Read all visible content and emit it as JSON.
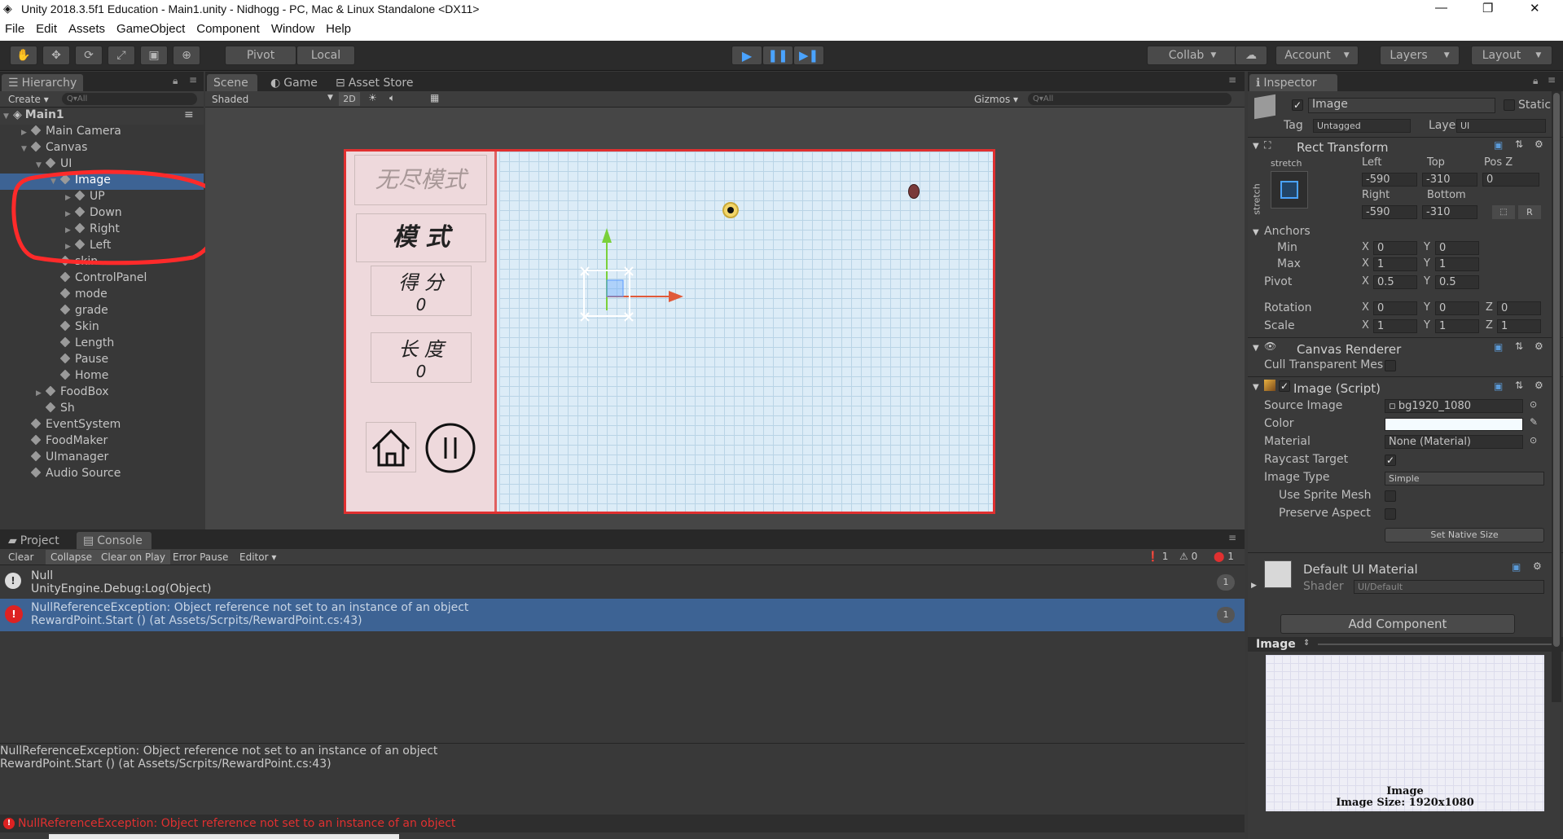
{
  "window": {
    "title": "Unity 2018.3.5f1 Education - Main1.unity - Nidhogg - PC, Mac & Linux Standalone <DX11>",
    "minimize": "—",
    "maximize": "❐",
    "close": "✕"
  },
  "menu": [
    "File",
    "Edit",
    "Assets",
    "GameObject",
    "Component",
    "Window",
    "Help"
  ],
  "toolbar": {
    "pivot": "Pivot",
    "local": "Local",
    "collab": "Collab",
    "account": "Account",
    "layers": "Layers",
    "layout": "Layout",
    "tools": [
      "✋",
      "✥",
      "⟳",
      "⤢",
      "▣",
      "⊕"
    ]
  },
  "hierarchy": {
    "tab": "Hierarchy",
    "create": "Create",
    "search_placeholder": "Q▾All",
    "scene": "Main1",
    "items": [
      {
        "label": "Main Camera",
        "depth": 1,
        "arrow": "▶"
      },
      {
        "label": "Canvas",
        "depth": 1,
        "arrow": "▼"
      },
      {
        "label": "UI",
        "depth": 2,
        "arrow": "▼"
      },
      {
        "label": "Image",
        "depth": 3,
        "arrow": "▼",
        "selected": true
      },
      {
        "label": "UP",
        "depth": 4,
        "arrow": "▶"
      },
      {
        "label": "Down",
        "depth": 4,
        "arrow": "▶"
      },
      {
        "label": "Right",
        "depth": 4,
        "arrow": "▶"
      },
      {
        "label": "Left",
        "depth": 4,
        "arrow": "▶"
      },
      {
        "label": "skin",
        "depth": 3,
        "arrow": ""
      },
      {
        "label": "ControlPanel",
        "depth": 3,
        "arrow": ""
      },
      {
        "label": "mode",
        "depth": 3,
        "arrow": ""
      },
      {
        "label": "grade",
        "depth": 3,
        "arrow": ""
      },
      {
        "label": "Skin",
        "depth": 3,
        "arrow": ""
      },
      {
        "label": "Length",
        "depth": 3,
        "arrow": ""
      },
      {
        "label": "Pause",
        "depth": 3,
        "arrow": ""
      },
      {
        "label": "Home",
        "depth": 3,
        "arrow": ""
      },
      {
        "label": "FoodBox",
        "depth": 2,
        "arrow": "▶"
      },
      {
        "label": "Sh",
        "depth": 2,
        "arrow": ""
      },
      {
        "label": "EventSystem",
        "depth": 1,
        "arrow": ""
      },
      {
        "label": "FoodMaker",
        "depth": 1,
        "arrow": ""
      },
      {
        "label": "UImanager",
        "depth": 1,
        "arrow": ""
      },
      {
        "label": "Audio Source",
        "depth": 1,
        "arrow": ""
      }
    ]
  },
  "scene": {
    "tabs": [
      "Scene",
      "Game",
      "Asset Store"
    ],
    "shading": "Shaded",
    "mode2d": "2D",
    "gizmos": "Gizmos",
    "search_placeholder": "Q▾All",
    "game": {
      "title": "无尽模式",
      "mode_label": "模 式",
      "score_label": "得 分",
      "score_value": "0",
      "length_label": "长 度",
      "length_value": "0"
    }
  },
  "console": {
    "tabs": [
      "Project",
      "Console"
    ],
    "buttons": [
      "Clear",
      "Collapse",
      "Clear on Play",
      "Error Pause",
      "Editor"
    ],
    "counts": {
      "info": "1",
      "warn": "0",
      "error": "1"
    },
    "entries": [
      {
        "line1": "Null",
        "line2": "UnityEngine.Debug:Log(Object)",
        "count": "1",
        "type": "info"
      },
      {
        "line1": "NullReferenceException: Object reference not set to an instance of an object",
        "line2": "RewardPoint.Start () (at Assets/Scrpits/RewardPoint.cs:43)",
        "count": "1",
        "type": "error"
      }
    ],
    "detail1": "NullReferenceException: Object reference not set to an instance of an object",
    "detail2": "RewardPoint.Start () (at Assets/Scrpits/RewardPoint.cs:43)",
    "status": "NullReferenceException: Object reference not set to an instance of an object"
  },
  "inspector": {
    "tab": "Inspector",
    "name": "Image",
    "static": "Static",
    "tag_label": "Tag",
    "tag": "Untagged",
    "layer_label": "Layer",
    "layer": "UI",
    "rect": {
      "title": "Rect Transform",
      "stretch": "stretch",
      "stretch_v": "stretch",
      "h1": [
        "Left",
        "Top",
        "Pos Z"
      ],
      "v1": [
        "-590",
        "-310",
        "0"
      ],
      "h2": [
        "Right",
        "Bottom"
      ],
      "v2": [
        "-590",
        "-310"
      ],
      "r_btn": "R",
      "anchors": "Anchors",
      "min": "Min",
      "max": "Max",
      "pivot": "Pivot",
      "min_x": "0",
      "min_y": "0",
      "max_x": "1",
      "max_y": "1",
      "pivot_x": "0.5",
      "pivot_y": "0.5",
      "rotation": "Rotation",
      "rot": [
        "0",
        "0",
        "0"
      ],
      "scale": "Scale",
      "scl": [
        "1",
        "1",
        "1"
      ],
      "x": "X",
      "y": "Y",
      "z": "Z"
    },
    "canvas_renderer": {
      "title": "Canvas Renderer",
      "cull": "Cull Transparent Mes"
    },
    "image": {
      "title": "Image (Script)",
      "source_label": "Source Image",
      "source": "bg1920_1080",
      "color_label": "Color",
      "material_label": "Material",
      "material": "None (Material)",
      "raycast": "Raycast Target",
      "image_type_label": "Image Type",
      "image_type": "Simple",
      "sprite_mesh": "Use Sprite Mesh",
      "preserve": "Preserve Aspect",
      "native": "Set Native Size"
    },
    "material": {
      "title": "Default UI Material",
      "shader_label": "Shader",
      "shader": "UI/Default"
    },
    "add_component": "Add Component",
    "preview": {
      "title": "Image",
      "caption1": "Image",
      "caption2": "Image Size: 1920x1080"
    }
  },
  "colors": {
    "accent": "#3d6394",
    "error": "#e03030",
    "annotation": "#ff2a2a"
  }
}
